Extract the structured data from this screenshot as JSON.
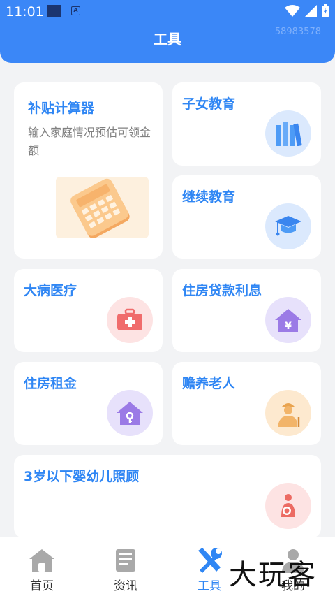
{
  "status": {
    "time": "11:01",
    "badge": "A"
  },
  "header": {
    "title": "工具",
    "watermark": "58983578"
  },
  "cards": {
    "calc": {
      "title": "补贴计算器",
      "desc": "输入家庭情况预估可领金额"
    },
    "children_edu": {
      "title": "子女教育",
      "icon": "books-icon"
    },
    "continuing_edu": {
      "title": "继续教育",
      "icon": "graduation-cap-icon"
    },
    "medical": {
      "title": "大病医疗",
      "icon": "medical-kit-icon"
    },
    "mortgage": {
      "title": "住房贷款利息",
      "icon": "house-yen-icon"
    },
    "rent": {
      "title": "住房租金",
      "icon": "house-key-icon"
    },
    "elderly": {
      "title": "赡养老人",
      "icon": "elderly-person-icon"
    },
    "infant": {
      "title": "3岁以下婴幼儿照顾",
      "icon": "mother-baby-icon"
    }
  },
  "tabs": [
    {
      "label": "首页",
      "icon": "home-icon"
    },
    {
      "label": "资讯",
      "icon": "news-icon"
    },
    {
      "label": "工具",
      "icon": "tools-icon",
      "active": true
    },
    {
      "label": "我的",
      "icon": "profile-icon"
    }
  ],
  "brand": "大玩客",
  "colors": {
    "primary": "#3b87f7",
    "title_blue": "#2f86f4",
    "background": "#f2f3f5"
  }
}
